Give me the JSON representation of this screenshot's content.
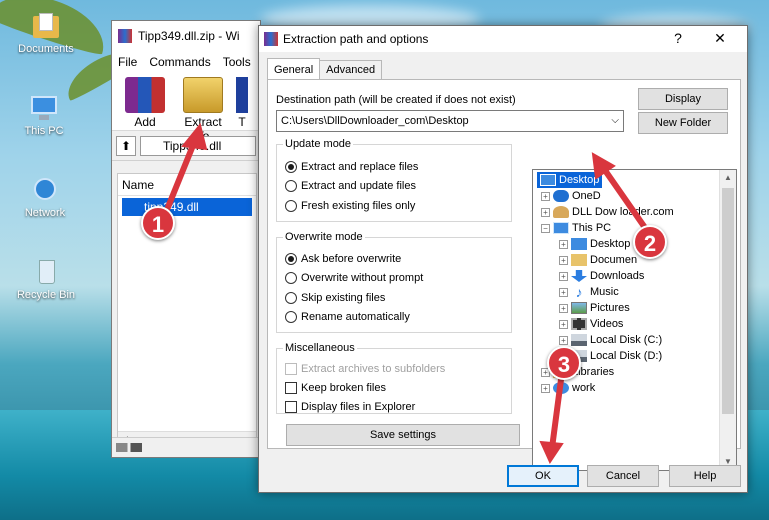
{
  "desktop": {
    "icons": [
      {
        "label": "Documents"
      },
      {
        "label": "This PC"
      },
      {
        "label": "Network"
      },
      {
        "label": "Recycle Bin"
      }
    ]
  },
  "winrar": {
    "title": "Tipp349.dll.zip - Wi",
    "menu": [
      "File",
      "Commands",
      "Tools"
    ],
    "toolbar": {
      "add_label": "Add",
      "extract_label": "Extract To",
      "more_label": "T"
    },
    "path": "Tipp349.dll",
    "column_name": "Name",
    "file": "tipp349.dll"
  },
  "dialog": {
    "title": "Extraction path and options",
    "help": "?",
    "close": "✕",
    "tabs": [
      "General",
      "Advanced"
    ],
    "dest_label": "Destination path (will be created if does not exist)",
    "dest_value": "C:\\Users\\DllDownloader_com\\Desktop",
    "display_button": "Display",
    "new_folder_button": "New Folder",
    "update_mode": {
      "title": "Update mode",
      "options": [
        "Extract and replace files",
        "Extract and update files",
        "Fresh existing files only"
      ],
      "selected": 0
    },
    "overwrite_mode": {
      "title": "Overwrite mode",
      "options": [
        "Ask before overwrite",
        "Overwrite without prompt",
        "Skip existing files",
        "Rename automatically"
      ],
      "selected": 0
    },
    "misc": {
      "title": "Miscellaneous",
      "options": [
        "Extract archives to subfolders",
        "Keep broken files",
        "Display files in Explorer"
      ]
    },
    "save_settings": "Save settings",
    "tree": [
      "Desktop",
      "OneD",
      "DLL Dow   loader.com",
      "This PC",
      "Desktop",
      "Documen",
      "Downloads",
      "Music",
      "Pictures",
      "Videos",
      "Local Disk (C:)",
      "Local Disk (D:)",
      "Libraries",
      "work"
    ],
    "ok": "OK",
    "cancel": "Cancel",
    "help_button": "Help"
  },
  "annotations": [
    "1",
    "2",
    "3"
  ],
  "colors": {
    "accent": "#0a64d8",
    "badge": "#d9363e"
  }
}
